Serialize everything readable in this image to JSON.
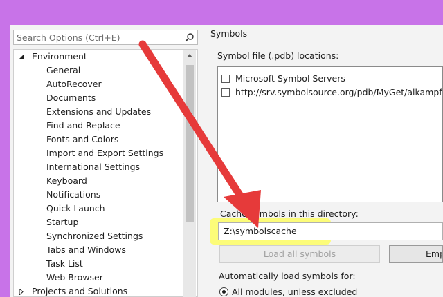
{
  "search": {
    "placeholder": "Search Options (Ctrl+E)"
  },
  "tree": {
    "environment": {
      "label": "Environment",
      "expanded": true,
      "items": [
        "General",
        "AutoRecover",
        "Documents",
        "Extensions and Updates",
        "Find and Replace",
        "Fonts and Colors",
        "Import and Export Settings",
        "International Settings",
        "Keyboard",
        "Notifications",
        "Quick Launch",
        "Startup",
        "Synchronized Settings",
        "Tabs and Windows",
        "Task List",
        "Web Browser"
      ]
    },
    "projects": {
      "label": "Projects and Solutions",
      "expanded": false
    }
  },
  "panel": {
    "title": "Symbols",
    "locations_label": "Symbol file (.pdb) locations:",
    "locations": [
      {
        "label": "Microsoft Symbol Servers",
        "checked": false
      },
      {
        "label": "http://srv.symbolsource.org/pdb/MyGet/alkampfer",
        "checked": false
      }
    ],
    "cache_label": "Cache symbols in this directory:",
    "cache_value": "Z:\\symbolscache",
    "load_all_button": "Load all symbols",
    "empty_button": "Emp",
    "auto_load_label": "Automatically load symbols for:",
    "radio_all": "All modules, unless excluded"
  },
  "colors": {
    "window_frame": "#c873e8",
    "annotation_arrow": "#e63a3a",
    "highlight": "#ffff50"
  }
}
